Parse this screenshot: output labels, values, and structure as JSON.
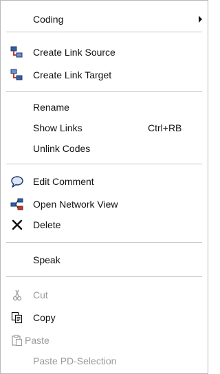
{
  "menu": {
    "coding": "Coding",
    "create_link_source": "Create Link Source",
    "create_link_target": "Create Link Target",
    "rename": "Rename",
    "show_links": "Show Links",
    "show_links_shortcut": "Ctrl+RB",
    "unlink_codes": "Unlink Codes",
    "edit_comment": "Edit Comment",
    "open_network_view": "Open Network View",
    "delete": "Delete",
    "speak": "Speak",
    "cut": "Cut",
    "copy": "Copy",
    "paste": "Paste",
    "paste_pd_selection": "Paste PD-Selection"
  },
  "colors": {
    "enabled_text": "#111111",
    "disabled_text": "#9a9a9a",
    "separator": "#c6c6c6",
    "link_icon_blue": "#2f5fa8",
    "link_icon_red": "#c0392b"
  },
  "icons": {
    "create_link_source": "link-source-icon",
    "create_link_target": "link-target-icon",
    "edit_comment": "comment-bubble-icon",
    "open_network_view": "network-view-icon",
    "delete": "delete-x-icon",
    "cut": "scissors-icon",
    "copy": "copy-icon",
    "paste": "paste-icon"
  }
}
